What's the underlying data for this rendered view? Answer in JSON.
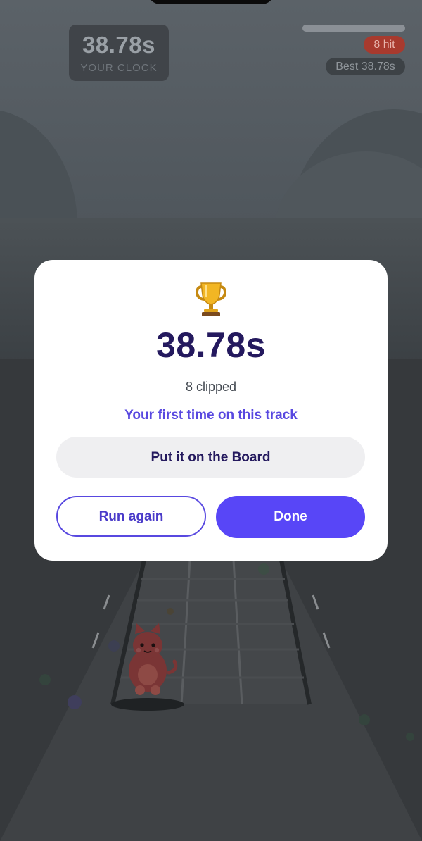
{
  "hud": {
    "clock_value": "38.78s",
    "clock_label": "YOUR CLOCK",
    "track_progress": 0,
    "hit_badge": "8 hit",
    "best_badge": "Best 38.78s"
  },
  "result": {
    "trophy_icon": "trophy-icon",
    "time": "38.78s",
    "clipped": "8 clipped",
    "first_time_note": "Your first time on this track",
    "board_button": "Put it on the Board",
    "run_again_button": "Run again",
    "done_button": "Done"
  },
  "colors": {
    "accent": "#5846f7",
    "title_navy": "#24195e",
    "hit_red": "#a83a2e"
  }
}
